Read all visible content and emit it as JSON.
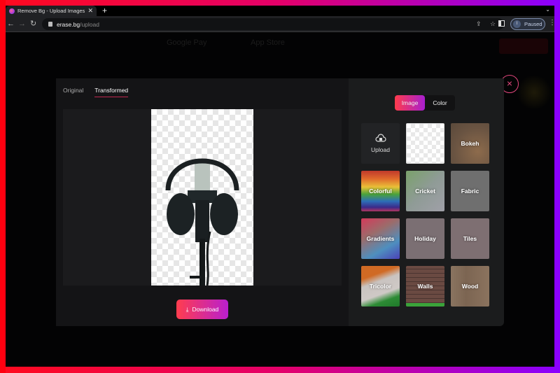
{
  "browser": {
    "tab_title": "Remove Bg - Upload Images to",
    "url_domain": "erase.bg",
    "url_path": "/upload",
    "profile_initial": "I",
    "profile_status": "Paused"
  },
  "background_site": {
    "google_play": "Google Pay",
    "app_store": "App Store"
  },
  "modal": {
    "tabs": [
      {
        "label": "Original",
        "active": false
      },
      {
        "label": "Transformed",
        "active": true
      }
    ],
    "download_label": "Download",
    "bg_mode": [
      {
        "label": "Image",
        "active": true
      },
      {
        "label": "Color",
        "active": false
      }
    ],
    "backgrounds": [
      {
        "label": "Upload",
        "kind": "upload"
      },
      {
        "label": "",
        "kind": "transparent"
      },
      {
        "label": "Bokeh",
        "kind": "bokeh"
      },
      {
        "label": "Colorful",
        "kind": "colorful"
      },
      {
        "label": "Cricket",
        "kind": "cricket"
      },
      {
        "label": "Fabric",
        "kind": "fabric"
      },
      {
        "label": "Gradients",
        "kind": "gradients"
      },
      {
        "label": "Holiday",
        "kind": "holiday"
      },
      {
        "label": "Tiles",
        "kind": "tiles"
      },
      {
        "label": "Tricolor",
        "kind": "tricolor"
      },
      {
        "label": "Walls",
        "kind": "walls"
      },
      {
        "label": "Wood",
        "kind": "wood"
      }
    ],
    "accent_start": "#ff3b4c",
    "accent_end": "#a81fd0",
    "close_color": "#e0467c"
  }
}
